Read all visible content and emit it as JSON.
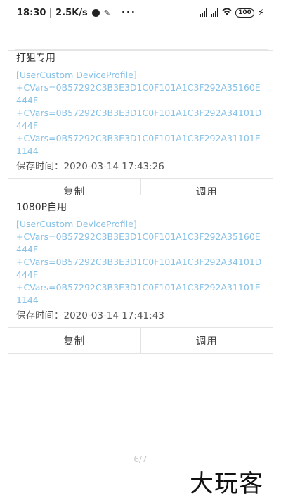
{
  "status_bar": {
    "time_net": "18:30 | 2.5K/s",
    "more": "···",
    "battery": "100",
    "charging": "⚡"
  },
  "cards": [
    {
      "title": "打狙专用",
      "profile_lines": [
        "[UserCustom DeviceProfile]",
        "+CVars=0B57292C3B3E3D1C0F101A1C3F292A35160E444F",
        "+CVars=0B57292C3B3E3D1C0F101A1C3F292A34101D444F",
        "+CVars=0B57292C3B3E3D1C0F101A1C3F292A31101E1144"
      ],
      "saved_time": "保存时间：2020-03-14 17:43:26",
      "copy_label": "复制",
      "apply_label": "调用"
    },
    {
      "title": "1080P自用",
      "profile_lines": [
        "[UserCustom DeviceProfile]",
        "+CVars=0B57292C3B3E3D1C0F101A1C3F292A35160E444F",
        "+CVars=0B57292C3B3E3D1C0F101A1C3F292A34101D444F",
        "+CVars=0B57292C3B3E3D1C0F101A1C3F292A31101E1144"
      ],
      "saved_time": "保存时间：2020-03-14 17:41:43",
      "copy_label": "复制",
      "apply_label": "调用"
    }
  ],
  "pager": "6/7",
  "watermark": "大玩客",
  "colors": {
    "profile_text": "#86c1e6",
    "border": "#e3e3e3"
  }
}
